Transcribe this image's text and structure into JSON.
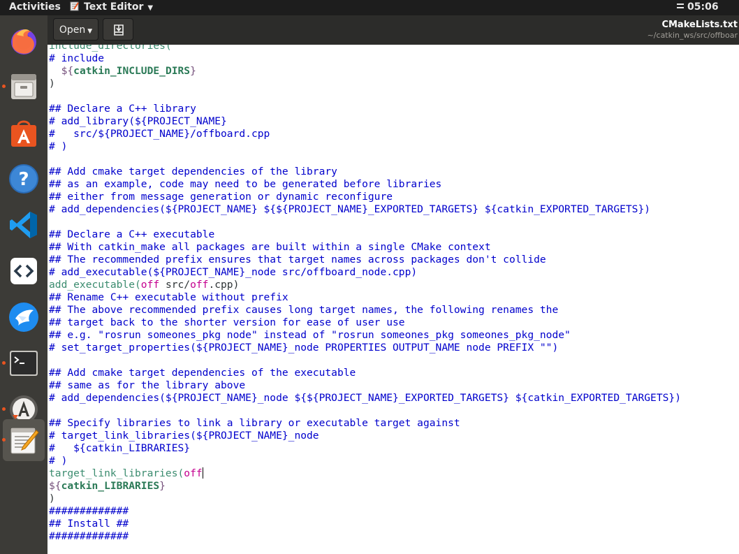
{
  "topbar": {
    "activities": "Activities",
    "app_name": "Text Editor",
    "app_icon": "text-editor-icon",
    "clock": "05:06"
  },
  "dock": {
    "items": [
      {
        "name": "firefox",
        "icon": "firefox-icon",
        "running": false,
        "active": false
      },
      {
        "name": "files",
        "icon": "file-cabinet-icon",
        "running": true,
        "active": false
      },
      {
        "name": "software",
        "icon": "ubuntu-software-icon",
        "running": false,
        "active": false
      },
      {
        "name": "help",
        "icon": "help-icon",
        "running": false,
        "active": false
      },
      {
        "name": "vscode",
        "icon": "vscode-icon",
        "running": false,
        "active": false
      },
      {
        "name": "qtcreator",
        "icon": "code-brackets-icon",
        "running": false,
        "active": false
      },
      {
        "name": "feishu",
        "icon": "bird-icon",
        "running": false,
        "active": false
      },
      {
        "name": "terminal",
        "icon": "terminal-icon",
        "running": true,
        "active": false
      },
      {
        "name": "updater",
        "icon": "software-updater-icon",
        "running": true,
        "active": false
      },
      {
        "name": "text-editor",
        "icon": "text-editor-icon",
        "running": true,
        "active": true
      }
    ]
  },
  "header": {
    "open_label": "Open",
    "save_icon": "save-document-icon",
    "title": "CMakeLists.txt",
    "subtitle": "~/catkin_ws/src/offboar"
  },
  "editor": {
    "lines": [
      [
        {
          "t": "include_directories(",
          "s": "fn"
        }
      ],
      [
        {
          "t": "# include",
          "s": "com"
        }
      ],
      [
        {
          "t": "  ${",
          "s": "var"
        },
        {
          "t": "catkin_INCLUDE_DIRS",
          "s": "bold"
        },
        {
          "t": "}",
          "s": "var"
        }
      ],
      [
        {
          "t": ")",
          "s": "plain"
        }
      ],
      [
        {
          "t": "",
          "s": "plain"
        }
      ],
      [
        {
          "t": "## Declare a C++ library",
          "s": "com"
        }
      ],
      [
        {
          "t": "# add_library(${PROJECT_NAME}",
          "s": "com"
        }
      ],
      [
        {
          "t": "#   src/${PROJECT_NAME}/offboard.cpp",
          "s": "com"
        }
      ],
      [
        {
          "t": "# )",
          "s": "com"
        }
      ],
      [
        {
          "t": "",
          "s": "plain"
        }
      ],
      [
        {
          "t": "## Add cmake target dependencies of the library",
          "s": "com"
        }
      ],
      [
        {
          "t": "## as an example, code may need to be generated before libraries",
          "s": "com"
        }
      ],
      [
        {
          "t": "## either from message generation or dynamic reconfigure",
          "s": "com"
        }
      ],
      [
        {
          "t": "# add_dependencies(${PROJECT_NAME} ${${PROJECT_NAME}_EXPORTED_TARGETS} ${catkin_EXPORTED_TARGETS})",
          "s": "com"
        }
      ],
      [
        {
          "t": "",
          "s": "plain"
        }
      ],
      [
        {
          "t": "## Declare a C++ executable",
          "s": "com"
        }
      ],
      [
        {
          "t": "## With catkin_make all packages are built within a single CMake context",
          "s": "com"
        }
      ],
      [
        {
          "t": "## The recommended prefix ensures that target names across packages don't collide",
          "s": "com"
        }
      ],
      [
        {
          "t": "# add_executable(${PROJECT_NAME}_node src/offboard_node.cpp)",
          "s": "com"
        }
      ],
      [
        {
          "t": "add_executable(",
          "s": "fn"
        },
        {
          "t": "off",
          "s": "str"
        },
        {
          "t": " src/",
          "s": "plain"
        },
        {
          "t": "off",
          "s": "str"
        },
        {
          "t": ".cpp)",
          "s": "plain"
        }
      ],
      [
        {
          "t": "## Rename C++ executable without prefix",
          "s": "com"
        }
      ],
      [
        {
          "t": "## The above recommended prefix causes long target names, the following renames the",
          "s": "com"
        }
      ],
      [
        {
          "t": "## target back to the shorter version for ease of user use",
          "s": "com"
        }
      ],
      [
        {
          "t": "## e.g. \"rosrun someones_pkg node\" instead of \"rosrun someones_pkg someones_pkg_node\"",
          "s": "com"
        }
      ],
      [
        {
          "t": "# set_target_properties(${PROJECT_NAME}_node PROPERTIES OUTPUT_NAME node PREFIX \"\")",
          "s": "com"
        }
      ],
      [
        {
          "t": "",
          "s": "plain"
        }
      ],
      [
        {
          "t": "## Add cmake target dependencies of the executable",
          "s": "com"
        }
      ],
      [
        {
          "t": "## same as for the library above",
          "s": "com"
        }
      ],
      [
        {
          "t": "# add_dependencies(${PROJECT_NAME}_node ${${PROJECT_NAME}_EXPORTED_TARGETS} ${catkin_EXPORTED_TARGETS})",
          "s": "com"
        }
      ],
      [
        {
          "t": "",
          "s": "plain"
        }
      ],
      [
        {
          "t": "## Specify libraries to link a library or executable target against",
          "s": "com"
        }
      ],
      [
        {
          "t": "# target_link_libraries(${PROJECT_NAME}_node",
          "s": "com"
        }
      ],
      [
        {
          "t": "#   ${catkin_LIBRARIES}",
          "s": "com"
        }
      ],
      [
        {
          "t": "# )",
          "s": "com"
        }
      ],
      [
        {
          "t": "target_link_libraries(",
          "s": "fn"
        },
        {
          "t": "off",
          "s": "str"
        },
        {
          "t": "",
          "s": "cursor"
        }
      ],
      [
        {
          "t": "${",
          "s": "var"
        },
        {
          "t": "catkin_LIBRARIES",
          "s": "bold"
        },
        {
          "t": "}",
          "s": "var"
        }
      ],
      [
        {
          "t": ")",
          "s": "plain"
        }
      ],
      [
        {
          "t": "#############",
          "s": "com"
        }
      ],
      [
        {
          "t": "## Install ##",
          "s": "com"
        }
      ],
      [
        {
          "t": "#############",
          "s": "com"
        }
      ]
    ]
  }
}
